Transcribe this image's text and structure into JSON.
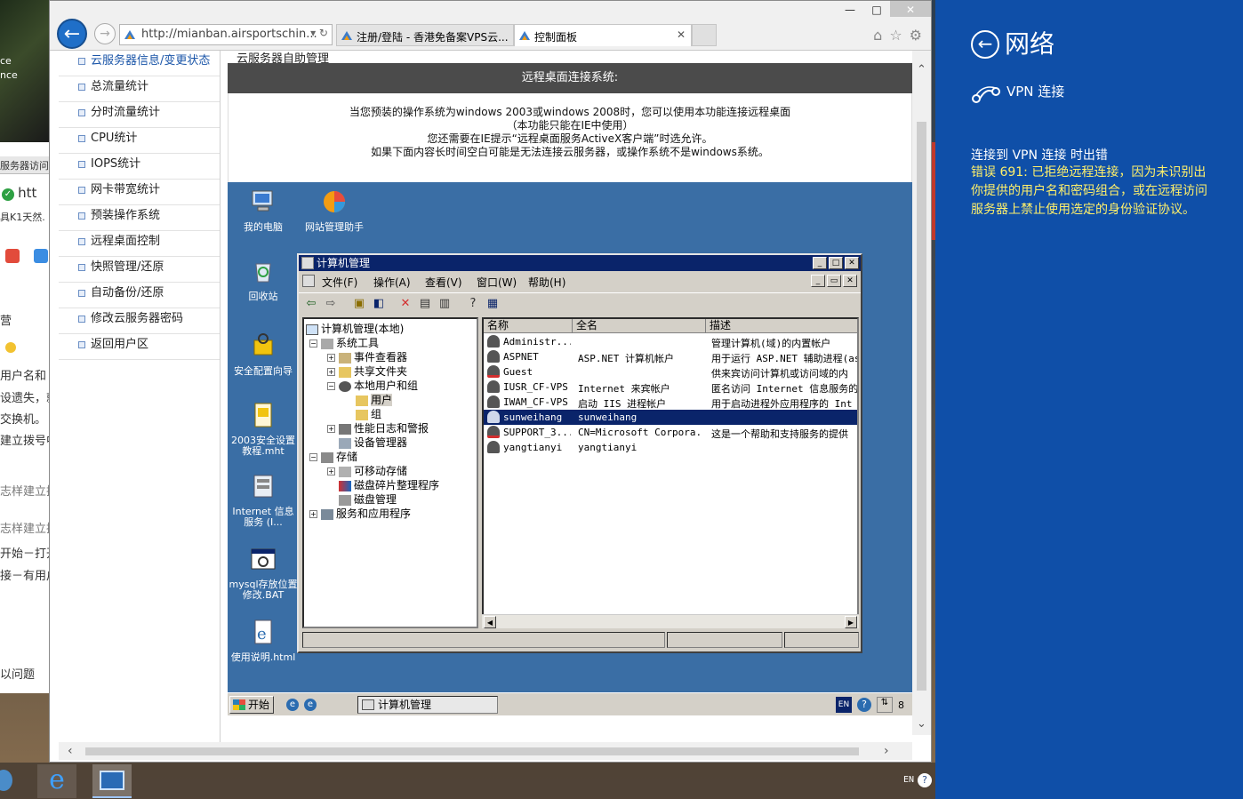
{
  "background_window": {
    "rows": [
      "ce",
      "nce",
      "服务器访问",
      "htt",
      "具K1天然.",
      "营",
      "用户名和",
      "设遗失，就",
      "交换机。",
      "建立拨号中",
      "志样建立拨",
      "志样建立拨",
      "开始－打开",
      "接－有用户",
      "以问题"
    ]
  },
  "ie": {
    "window_controls": [
      "—",
      "□",
      "✕"
    ],
    "address": "http://mianban.airsportschin...",
    "address_controls": "▾ ↻",
    "tabs": [
      {
        "label": "注册/登陆 - 香港免备案VPS云..."
      },
      {
        "label": "控制面板",
        "close": "✕"
      }
    ],
    "tools": [
      "⌂",
      "☆",
      "⚙"
    ],
    "nav_left": "←",
    "nav_right": "→"
  },
  "sidebar": {
    "items": [
      "云服务器信息/变更状态",
      "总流量统计",
      "分时流量统计",
      "CPU统计",
      "IOPS统计",
      "网卡带宽统计",
      "预装操作系统",
      "远程桌面控制",
      "快照管理/还原",
      "自动备份/还原",
      "修改云服务器密码",
      "返回用户区"
    ]
  },
  "main": {
    "title": "云服务器自助管理",
    "rdp_header": "远程桌面连接系统:",
    "info_lines": [
      "当您预装的操作系统为windows 2003或windows 2008时，您可以使用本功能连接远程桌面",
      "（本功能只能在IE中使用）",
      "您还需要在IE提示“远程桌面服务ActiveX客户端”时选允许。",
      "如果下面内容长时间空白可能是无法连接云服务器，或操作系统不是windows系统。"
    ]
  },
  "remote_desktop": {
    "icons": [
      {
        "label": "我的电脑"
      },
      {
        "label": "网站管理助手"
      },
      {
        "label": "回收站"
      },
      {
        "label": "安全配置向导"
      },
      {
        "label": "2003安全设置教程.mht"
      },
      {
        "label": "Internet 信息服务 (I..."
      },
      {
        "label": "mysql存放位置修改.BAT"
      },
      {
        "label": "使用说明.html"
      }
    ],
    "taskbar": {
      "start": "开始",
      "task": "计算机管理",
      "lang": "EN",
      "help": "?",
      "num": "8"
    }
  },
  "computer_mgmt": {
    "title": "计算机管理",
    "menus": [
      "文件(F)",
      "操作(A)",
      "查看(V)",
      "窗口(W)",
      "帮助(H)"
    ],
    "tree": [
      {
        "label": "计算机管理(本地)",
        "box": ""
      },
      {
        "label": "系统工具",
        "box": "−"
      },
      {
        "label": "事件查看器",
        "box": "+"
      },
      {
        "label": "共享文件夹",
        "box": "+"
      },
      {
        "label": "本地用户和组",
        "box": "−"
      },
      {
        "label": "用户",
        "box": ""
      },
      {
        "label": "组",
        "box": ""
      },
      {
        "label": "性能日志和警报",
        "box": "+"
      },
      {
        "label": "设备管理器",
        "box": ""
      },
      {
        "label": "存储",
        "box": "−"
      },
      {
        "label": "可移动存储",
        "box": "+"
      },
      {
        "label": "磁盘碎片整理程序",
        "box": ""
      },
      {
        "label": "磁盘管理",
        "box": ""
      },
      {
        "label": "服务和应用程序",
        "box": "+"
      }
    ],
    "columns": [
      "名称",
      "全名",
      "描述"
    ],
    "rows": [
      {
        "name": "Administr...",
        "full": "",
        "desc": "管理计算机(域)的内置帐户"
      },
      {
        "name": "ASPNET",
        "full": "ASP.NET 计算机帐户",
        "desc": "用于运行 ASP.NET 辅助进程(as"
      },
      {
        "name": "Guest",
        "full": "",
        "desc": "供来宾访问计算机或访问域的内"
      },
      {
        "name": "IUSR_CF-VPS",
        "full": "Internet 来宾帐户",
        "desc": "匿名访问 Internet 信息服务的"
      },
      {
        "name": "IWAM_CF-VPS",
        "full": "启动 IIS 进程帐户",
        "desc": "用于启动进程外应用程序的 Int"
      },
      {
        "name": "sunweihang",
        "full": "sunweihang",
        "desc": ""
      },
      {
        "name": "SUPPORT_3...",
        "full": "CN=Microsoft Corpora...",
        "desc": "这是一个帮助和支持服务的提供"
      },
      {
        "name": "yangtianyi",
        "full": "yangtianyi",
        "desc": ""
      }
    ]
  },
  "host_taskbar": {
    "lang": "EN",
    "help": "?"
  },
  "network_panel": {
    "back": "←",
    "title": "网络",
    "vpn_label": "VPN 连接",
    "error_title": "连接到 VPN 连接 时出错",
    "error_message": "错误 691: 已拒绝远程连接，因为未识别出你提供的用户名和密码组合，或在远程访问服务器上禁止使用选定的身份验证协议。"
  },
  "colors": {
    "panel_bg": "#0f4fa8",
    "error_text": "#fff06a",
    "remote_desktop_bg": "#3a6ea5",
    "win2003_title": "#0a246a"
  }
}
